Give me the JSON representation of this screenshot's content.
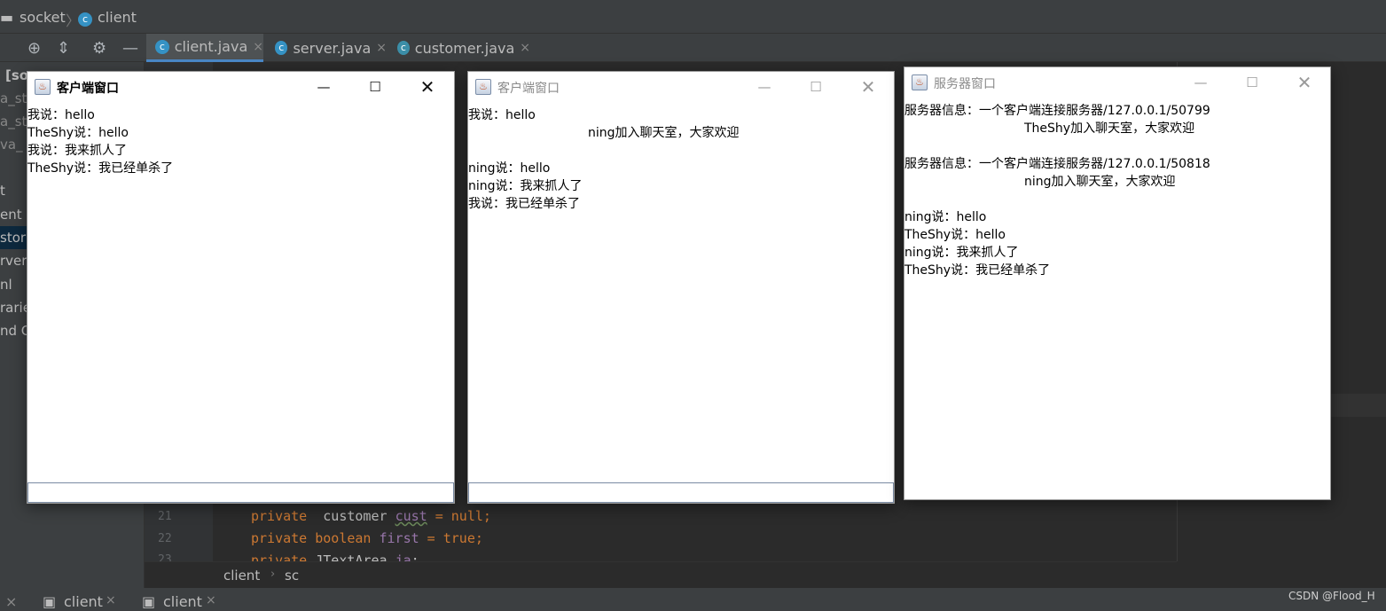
{
  "ide": {
    "breadcrumb": {
      "project": "socket",
      "file": "client"
    },
    "tabs": [
      {
        "label": "client.java",
        "active": true
      },
      {
        "label": "server.java",
        "active": false
      },
      {
        "label": "customer.java",
        "active": false
      }
    ],
    "project_items": [
      "[so",
      "a_st",
      "a_st",
      "va_",
      "t",
      "ent",
      "stor",
      "rver",
      "nl",
      "rarie",
      "nd C"
    ],
    "line_numbers": [
      "21",
      "22",
      "23"
    ],
    "code_lines": [
      {
        "kw": "private",
        "rest": "  customer ",
        "field": "cust",
        "tail": " = null;"
      },
      {
        "kw": "private boolean",
        "rest": " ",
        "field": "first",
        "tail": " = true;"
      },
      {
        "kw": "private",
        "rest": " JTextArea ",
        "field": "ja",
        "tail": ";"
      }
    ],
    "editor_breadcrumb": [
      "client",
      "sc"
    ],
    "run_tabs": [
      "client",
      "client"
    ],
    "colors": {
      "bg": "#2b2b2b",
      "panel": "#3c3f41",
      "keyword": "#cc7832",
      "field": "#9876aa",
      "accent": "#4a88c7"
    }
  },
  "windows": {
    "client1": {
      "title": "客户端窗口",
      "lines": [
        "我说：hello",
        "TheShy说：hello",
        "我说：我来抓人了",
        "TheShy说：我已经单杀了"
      ]
    },
    "client2": {
      "title": "客户端窗口",
      "lines": [
        "我说：hello",
        "ning加入聊天室，大家欢迎",
        "",
        "ning说：hello",
        "ning说：我来抓人了",
        "我说：我已经单杀了"
      ]
    },
    "server": {
      "title": "服务器窗口",
      "lines": [
        "服务器信息：一个客户端连接服务器/127.0.0.1/50799",
        "TheShy加入聊天室，大家欢迎",
        "",
        "服务器信息：一个客户端连接服务器/127.0.0.1/50818",
        "ning加入聊天室，大家欢迎",
        "",
        "ning说：hello",
        "TheShy说：hello",
        "ning说：我来抓人了",
        "TheShy说：我已经单杀了"
      ]
    }
  },
  "icons": {
    "minimize": "minimize-icon",
    "maximize": "maximize-icon",
    "close": "close-icon",
    "java_cup": "java-cup-icon"
  },
  "watermark": "CSDN @Flood_H"
}
